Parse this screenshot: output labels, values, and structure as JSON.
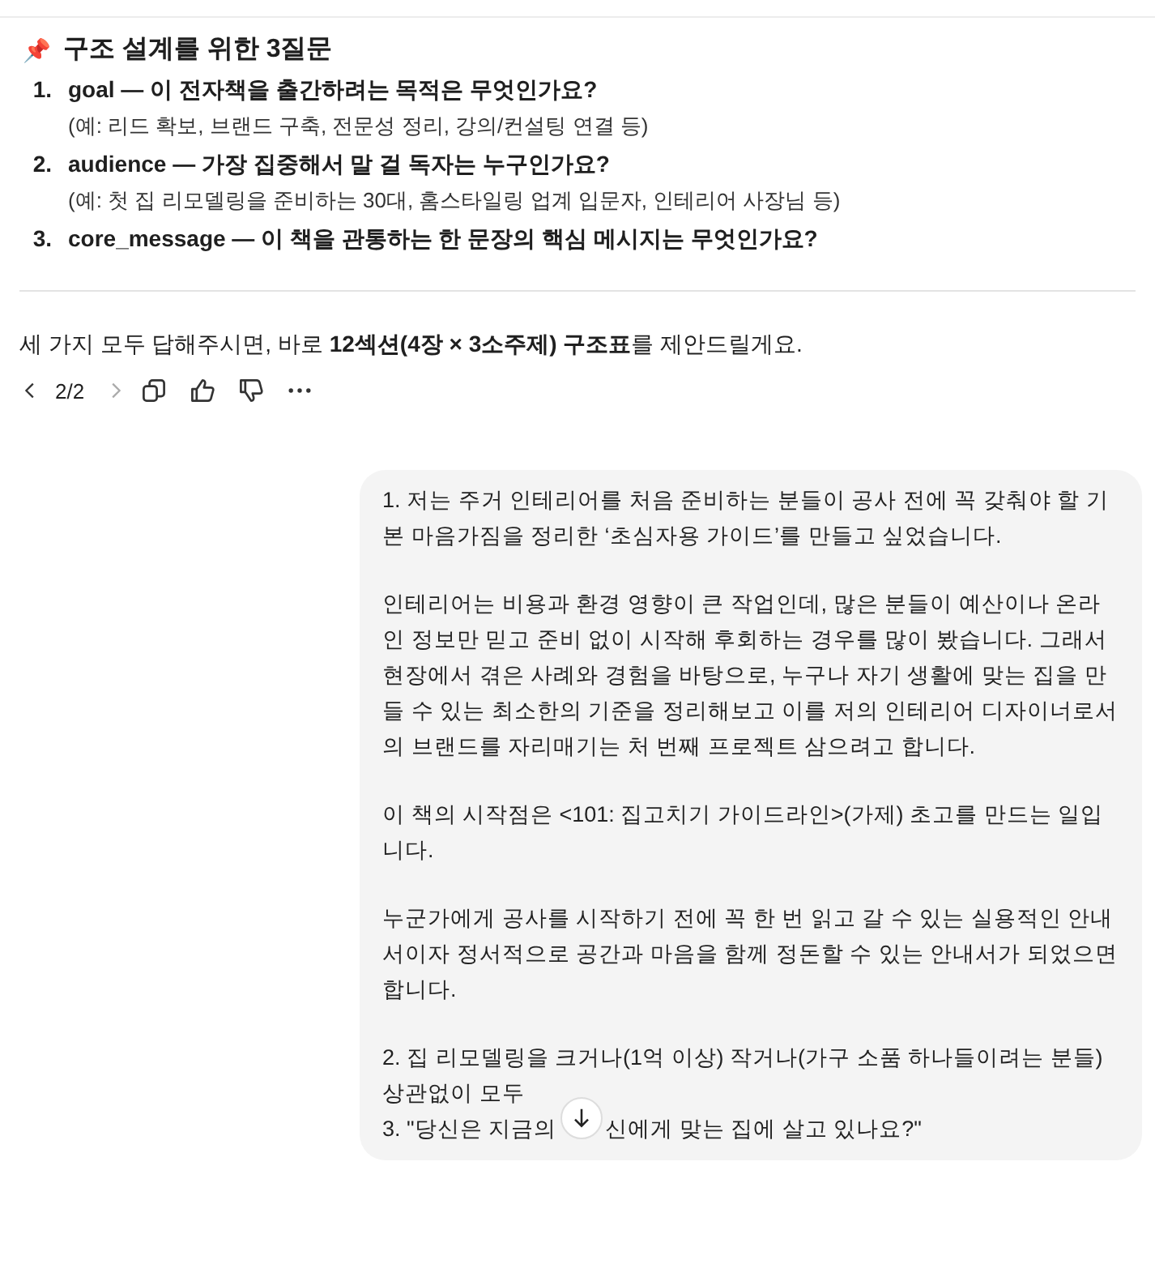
{
  "heading": {
    "icon": "📌",
    "title": "구조 설계를 위한 3질문"
  },
  "questions": [
    {
      "number": "1.",
      "text": "**goal — 이 전자책을 출간하려는 목적은 무엇인가요?**",
      "example": "(예: 리드 확보, 브랜드 구축, 전문성 정리, 강의/컨설팅 연결 등)"
    },
    {
      "number": "2.",
      "text": "**audience — 가장 집중해서 말 걸 독자는 누구인가요?**",
      "example": "(예: 첫 집 리모델링을 준비하는 30대, 홈스타일링 업계 입문자, 인테리어 사장님 등)"
    },
    {
      "number": "3.",
      "text": "**core_message — 이 책을 관통하는 한 문장의 핵심 메시지는 무엇인가요?**"
    }
  ],
  "closing": "세 가지 모두 답해주시면, 바로 **12섹션(4장 × 3소주제) 구조표**를 제안드릴게요.",
  "pager": {
    "label": "2/2"
  },
  "user_message": {
    "paragraphs": [
      "1. 저는 주거 인테리어를 처음 준비하는 분들이 공사 전에 꼭 갖춰야 할 기본 마음가짐을 정리한 ‘초심자용 가이드’를 만들고 싶었습니다.",
      "인테리어는 비용과 환경 영향이 큰 작업인데, 많은 분들이 예산이나 온라인 정보만 믿고 준비 없이 시작해 후회하는 경우를 많이 봤습니다. 그래서 현장에서 겪은 사례와 경험을 바탕으로, 누구나 자기 생활에 맞는 집을 만들 수 있는 최소한의 기준을 정리해보고 이를 저의 인테리어 디자이너로서의 브랜드를 자리매기는 처 번째 프로젝트 삼으려고 합니다.",
      "이 책의 시작점은 <101: 집고치기 가이드라인>(가제) 초고를 만드는 일입니다.",
      "누군가에게 공사를 시작하기 전에 꼭 한 번 읽고 갈 수 있는 실용적인 안내서이자 정서적으로 공간과 마음을 함께 정돈할 수 있는 안내서가 되었으면 합니다."
    ],
    "tail": [
      "2. 집 리모델링을 크거나(1억 이상) 작거나(가구 소품 하나들이려는 분들) 상관없이 모두"
    ],
    "last_line": {
      "before": "3. \"당신은 지금의",
      "after": "신에게 맞는 집에 살고 있나요?\""
    }
  }
}
